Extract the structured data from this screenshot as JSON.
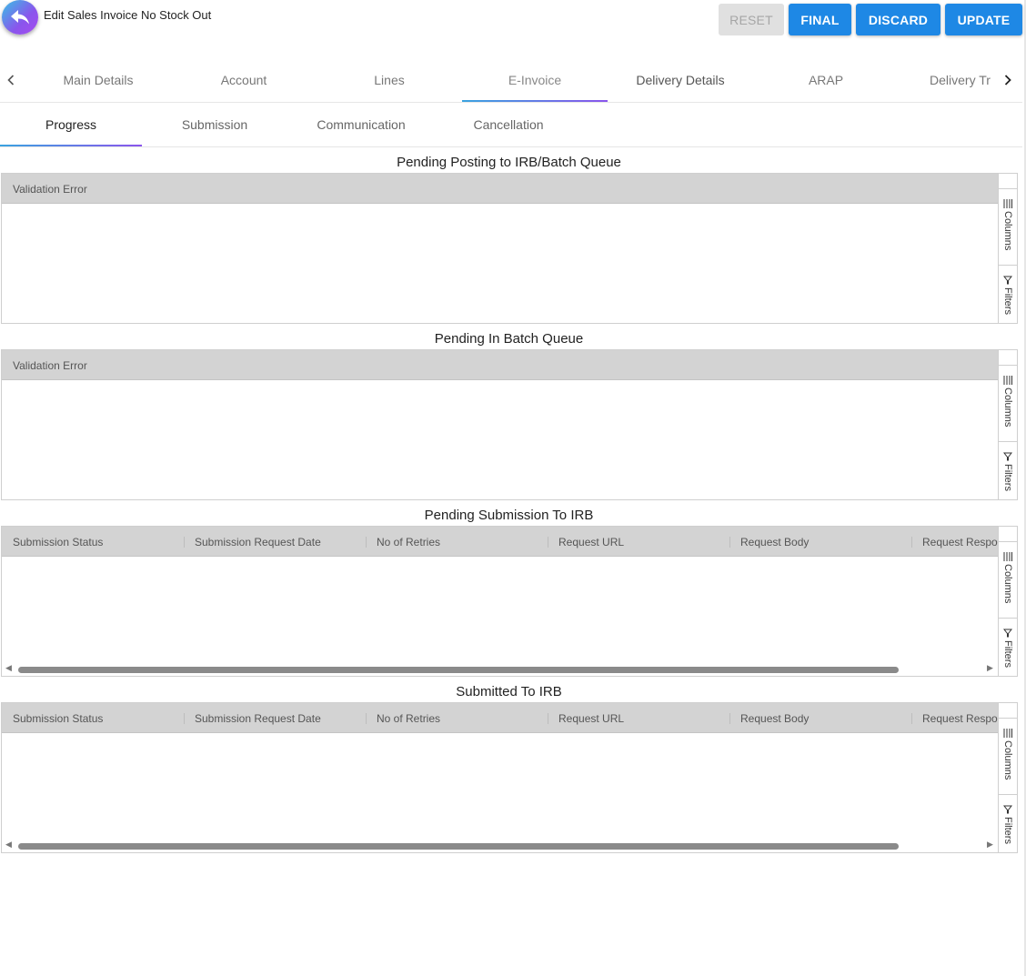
{
  "header": {
    "title": "Edit Sales Invoice No Stock Out",
    "back_icon": "reply-arrow-icon",
    "buttons": {
      "reset": "RESET",
      "final": "FINAL",
      "discard": "DISCARD",
      "update": "UPDATE"
    }
  },
  "main_tabs": [
    {
      "label": "Main Details"
    },
    {
      "label": "Account"
    },
    {
      "label": "Lines"
    },
    {
      "label": "E-Invoice",
      "active": true
    },
    {
      "label": "Delivery Details"
    },
    {
      "label": "ARAP"
    },
    {
      "label": "Delivery Tr"
    }
  ],
  "sub_tabs": [
    {
      "label": "Progress",
      "active": true
    },
    {
      "label": "Submission"
    },
    {
      "label": "Communication"
    },
    {
      "label": "Cancellation"
    }
  ],
  "side_panel": {
    "columns_label": "Columns",
    "filters_label": "Filters"
  },
  "sections": [
    {
      "title": "Pending Posting to IRB/Batch Queue",
      "columns": [
        "Validation Error"
      ]
    },
    {
      "title": "Pending In Batch Queue",
      "columns": [
        "Validation Error"
      ]
    },
    {
      "title": "Pending Submission To IRB",
      "columns": [
        "Submission Status",
        "Submission Request Date",
        "No of Retries",
        "Request URL",
        "Request Body",
        "Request Respor"
      ]
    },
    {
      "title": "Submitted To IRB",
      "columns": [
        "Submission Status",
        "Submission Request Date",
        "No of Retries",
        "Request URL",
        "Request Body",
        "Request Respor"
      ]
    }
  ],
  "colors": {
    "primary": "#1e88e5",
    "disabled": "#e0e0e0",
    "header_bg": "#d3d3d3",
    "tab_indicator": "#8a55ec"
  }
}
